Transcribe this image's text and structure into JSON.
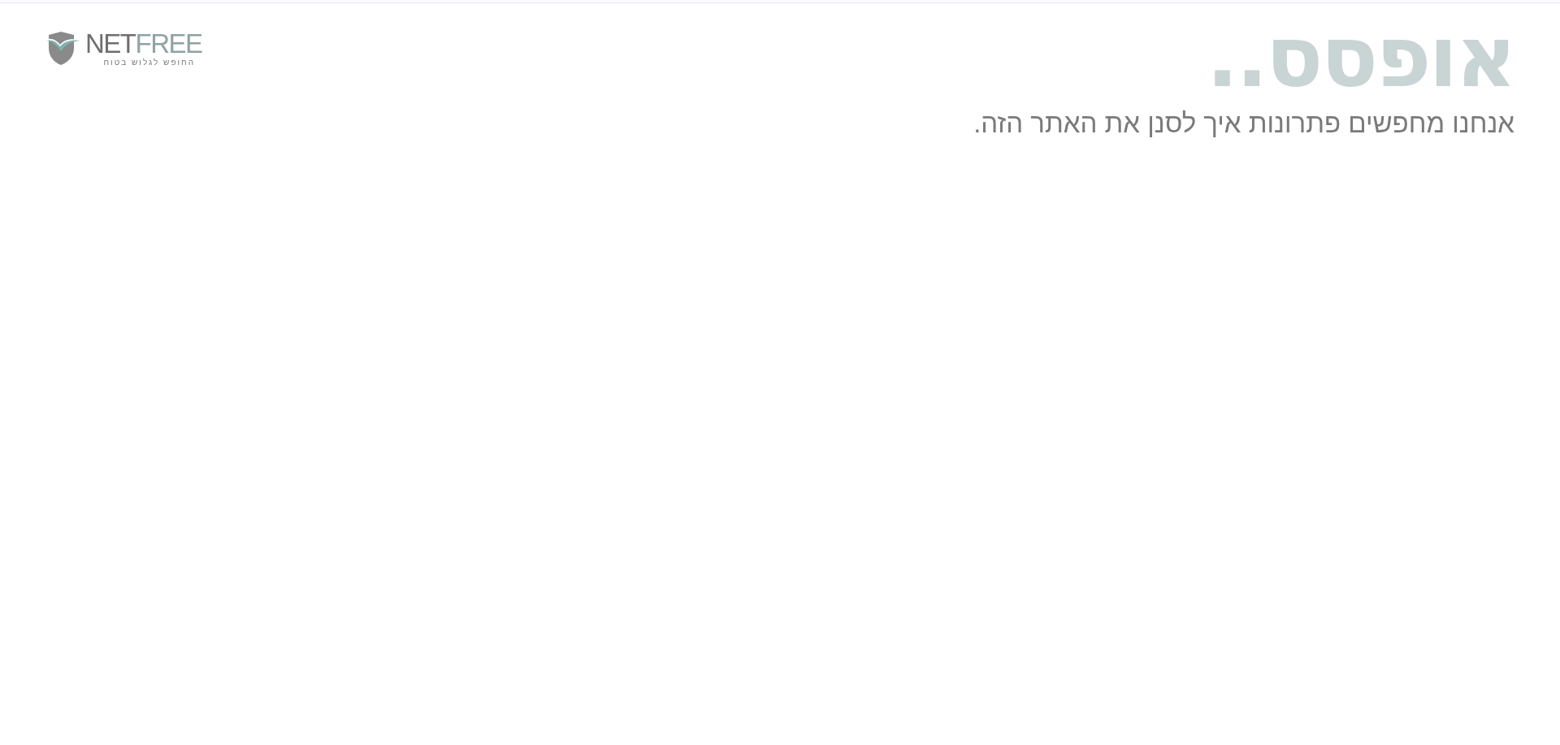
{
  "logo": {
    "brand_first": "NET",
    "brand_second": "FREE",
    "tagline": "החופש לגלוש בטוח"
  },
  "heading": "אופסס..",
  "message": "אנחנו מחפשים פתרונות איך לסנן את האתר הזה."
}
